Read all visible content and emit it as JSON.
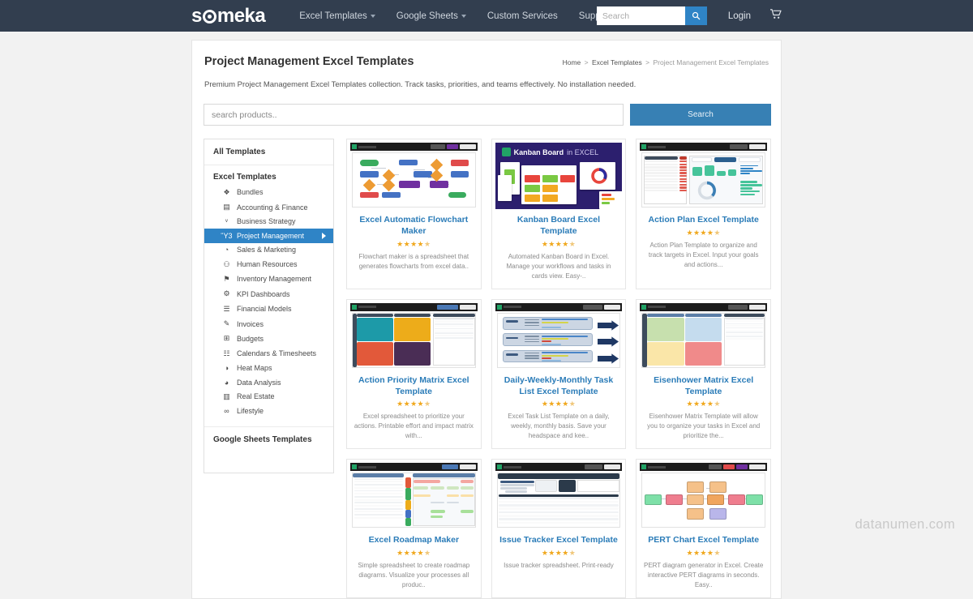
{
  "header": {
    "logo_text": "someka",
    "nav": [
      {
        "label": "Excel Templates",
        "caret": true
      },
      {
        "label": "Google Sheets",
        "caret": true
      },
      {
        "label": "Custom Services",
        "caret": false
      },
      {
        "label": "Support",
        "caret": true
      }
    ],
    "search_placeholder": "Search",
    "search_value": "",
    "login_label": "Login",
    "cart_icon": "shopping-cart-icon"
  },
  "page": {
    "title": "Project Management Excel Templates",
    "breadcrumb": {
      "home": "Home",
      "parent": "Excel Templates",
      "current": "Project Management Excel Templates",
      "separator": ">"
    },
    "description": "Premium Project Management Excel Templates collection. Track tasks, priorities, and teams effectively. No installation needed."
  },
  "product_search": {
    "placeholder": "search products..",
    "value": "",
    "button_label": "Search"
  },
  "sidebar": {
    "all_templates_label": "All Templates",
    "excel_section_label": "Excel Templates",
    "google_section_label": "Google Sheets Templates",
    "items": [
      {
        "label": "Bundles",
        "icon": "bundles-icon",
        "glyph": "❖",
        "active": false
      },
      {
        "label": "Accounting & Finance",
        "icon": "wallet-icon",
        "glyph": "▤",
        "active": false
      },
      {
        "label": "Business Strategy",
        "icon": "chart-line-icon",
        "glyph": "ᵛ",
        "active": false
      },
      {
        "label": "Project Management",
        "icon": "calendar-check-icon",
        "glyph": "Ὕ3",
        "active": true
      },
      {
        "label": "Sales & Marketing",
        "icon": "megaphone-icon",
        "glyph": "◔",
        "active": false
      },
      {
        "label": "Human Resources",
        "icon": "people-icon",
        "glyph": "⚇",
        "active": false
      },
      {
        "label": "Inventory Management",
        "icon": "tag-icon",
        "glyph": "⚑",
        "active": false
      },
      {
        "label": "KPI Dashboards",
        "icon": "gauge-icon",
        "glyph": "⚙",
        "active": false
      },
      {
        "label": "Financial Models",
        "icon": "bar-chart-icon",
        "glyph": "☰",
        "active": false
      },
      {
        "label": "Invoices",
        "icon": "invoice-pen-icon",
        "glyph": "✎",
        "active": false
      },
      {
        "label": "Budgets",
        "icon": "table-grid-icon",
        "glyph": "⊞",
        "active": false
      },
      {
        "label": "Calendars & Timesheets",
        "icon": "calendar-icon",
        "glyph": "☷",
        "active": false
      },
      {
        "label": "Heat Maps",
        "icon": "globe-icon",
        "glyph": "◑",
        "active": false
      },
      {
        "label": "Data Analysis",
        "icon": "pie-chart-icon",
        "glyph": "◕",
        "active": false
      },
      {
        "label": "Real Estate",
        "icon": "building-icon",
        "glyph": "▥",
        "active": false
      },
      {
        "label": "Lifestyle",
        "icon": "bicycle-icon",
        "glyph": "∞",
        "active": false
      }
    ]
  },
  "products": [
    {
      "title": "Excel Automatic Flowchart Maker",
      "rating": 4.5,
      "stars_full": 4,
      "stars_half": 1,
      "description": "Flowchart maker is a spreadsheet that generates flowcharts from excel data..",
      "thumb": "flowchart"
    },
    {
      "title": "Kanban Board Excel Template",
      "rating": 4.5,
      "stars_full": 4,
      "stars_half": 1,
      "description": "Automated Kanban Board in Excel. Manage your workflows and tasks in cards view. Easy-..",
      "thumb": "kanban",
      "thumb_heading_1": "Kanban Board",
      "thumb_heading_2": "in EXCEL"
    },
    {
      "title": "Action Plan Excel Template",
      "rating": 4.5,
      "stars_full": 4,
      "stars_half": 1,
      "description": "Action Plan Template to organize and track targets in Excel. Input your goals and actions...",
      "thumb": "actionplan"
    },
    {
      "title": "Action Priority Matrix Excel Template",
      "rating": 4.5,
      "stars_full": 4,
      "stars_half": 1,
      "description": "Excel spreadsheet to prioritize your actions. Printable effort and impact matrix with...",
      "thumb": "priority-matrix"
    },
    {
      "title": "Daily-Weekly-Monthly Task List Excel Template",
      "rating": 4.5,
      "stars_full": 4,
      "stars_half": 1,
      "description": "Excel Task List Template on a daily, weekly, monthly basis. Save your headspace and kee..",
      "thumb": "tasklist"
    },
    {
      "title": "Eisenhower Matrix Excel Template",
      "rating": 4.5,
      "stars_full": 4,
      "stars_half": 1,
      "description": "Eisenhower Matrix Template will allow you to organize your tasks in Excel and prioritize the...",
      "thumb": "eisenhower"
    },
    {
      "title": "Excel Roadmap Maker",
      "rating": 4.5,
      "stars_full": 4,
      "stars_half": 1,
      "description": "Simple spreadsheet to create roadmap diagrams. Visualize your processes all produc..",
      "thumb": "roadmap"
    },
    {
      "title": "Issue Tracker Excel Template",
      "rating": 4.5,
      "stars_full": 4,
      "stars_half": 1,
      "description": "Issue tracker spreadsheet. Print-ready",
      "thumb": "issuetracker"
    },
    {
      "title": "PERT Chart Excel Template",
      "rating": 4.5,
      "stars_full": 4,
      "stars_half": 1,
      "description": "PERT diagram generator in Excel. Create interactive PERT diagrams in seconds. Easy..",
      "thumb": "pert"
    }
  ],
  "watermark": "datanumen.com",
  "colors": {
    "header_bg": "#323e4f",
    "accent_blue": "#2f84c6",
    "button_blue": "#3780b4",
    "title_blue": "#2b7cb8",
    "star_gold": "#f0a81e",
    "page_bg": "#f2f2f2"
  }
}
